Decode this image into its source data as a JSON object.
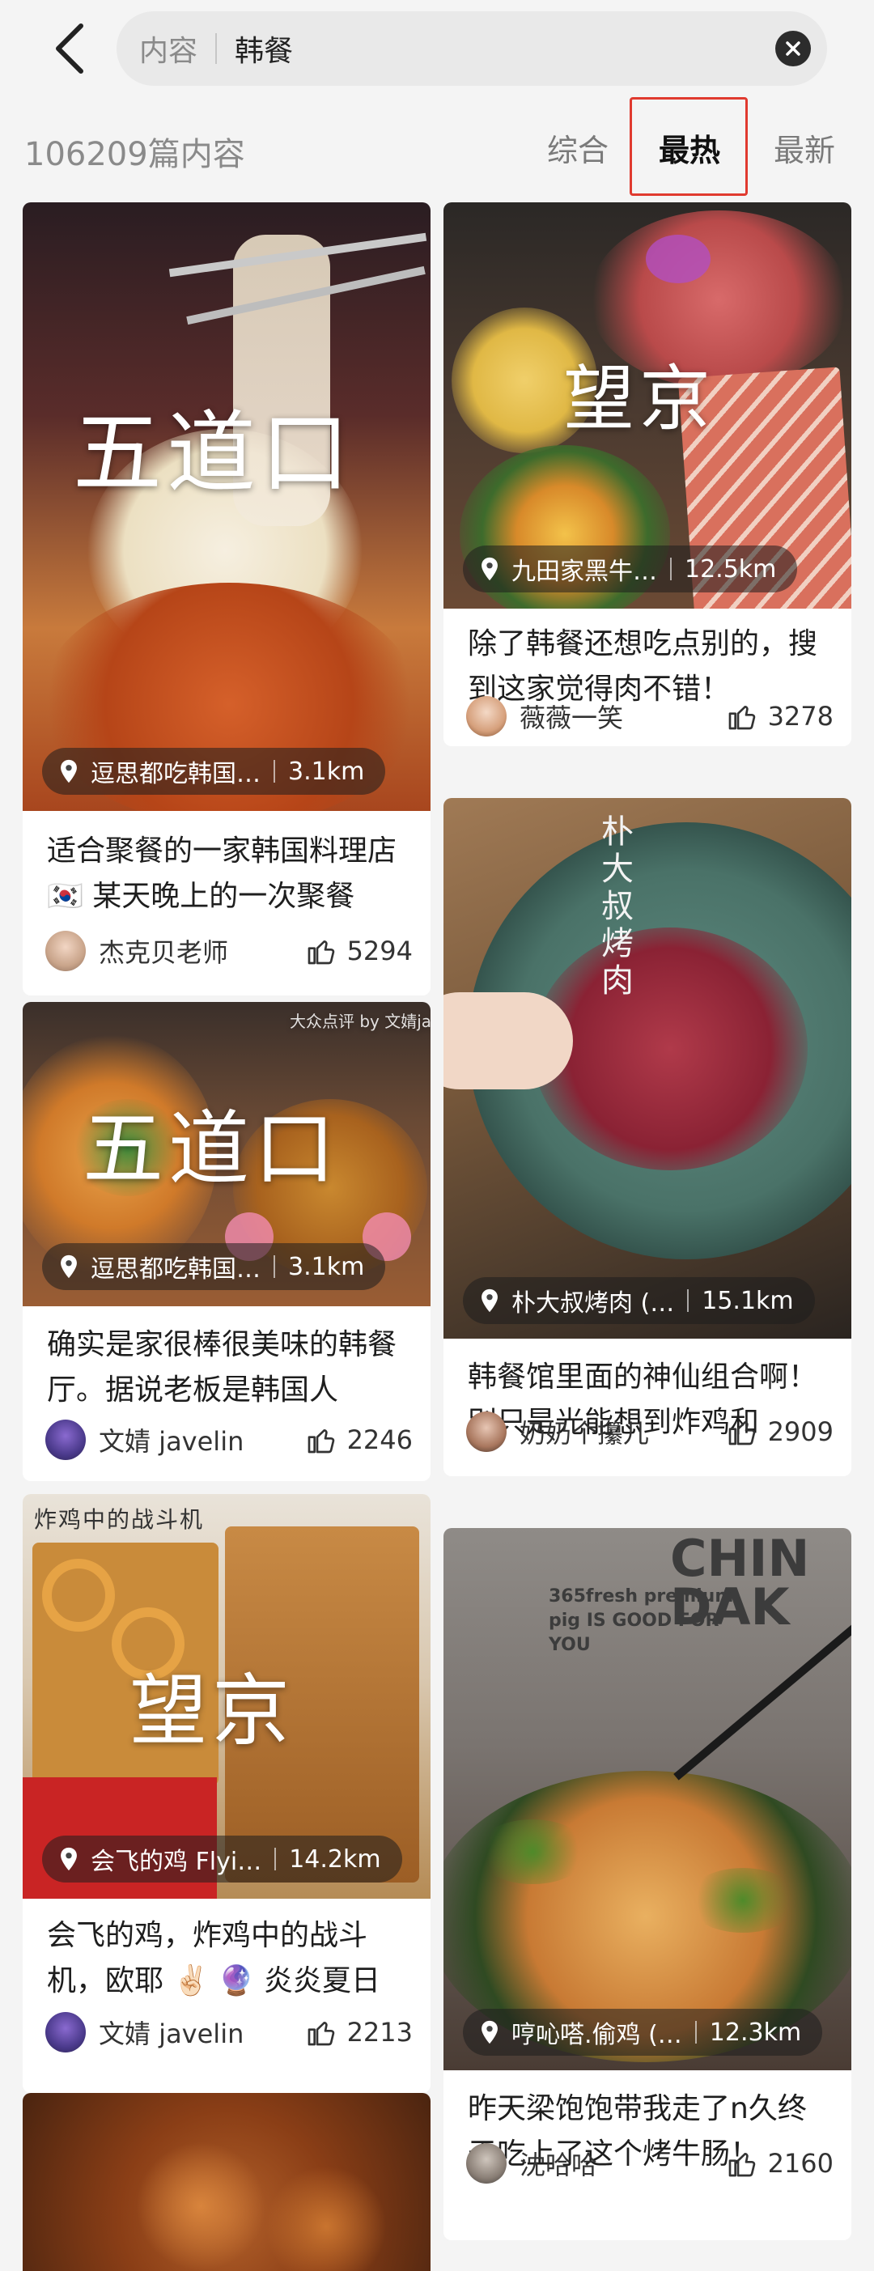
{
  "header": {
    "search_scope": "内容",
    "search_query": "韩餐"
  },
  "sortbar": {
    "result_count": "106209篇内容",
    "tabs": [
      {
        "label": "综合",
        "active": false
      },
      {
        "label": "最热",
        "active": true
      },
      {
        "label": "最新",
        "active": false
      }
    ]
  },
  "cards": [
    {
      "overlay": "五道口",
      "location": "逗思都吃韩国…",
      "distance": "3.1km",
      "title": "适合聚餐的一家韩国料理店 🇰🇷 某天晚上的一次聚餐",
      "author": "杰克贝老师",
      "likes": "5294"
    },
    {
      "overlay": "五道口",
      "watermark": "大众点评 by 文婧javelin VIP",
      "location": "逗思都吃韩国…",
      "distance": "3.1km",
      "title": "确实是家很棒很美味的韩餐厅。据说老板是韩国人",
      "author": "文婧 javelin",
      "likes": "2246"
    },
    {
      "overlay": "望京",
      "sign": "炸鸡中的战斗机",
      "location": "会飞的鸡 Flyi…",
      "distance": "14.2km",
      "title": "会飞的鸡，炸鸡中的战斗机，欧耶 ✌🏻 🔮 炎炎夏日",
      "author": "文婧 javelin",
      "likes": "2213"
    },
    {
      "overlay": "望京",
      "location": "九田家黑牛…",
      "distance": "12.5km",
      "title": "除了韩餐还想吃点别的，搜到这家觉得肉不错！",
      "author": "薇薇一笑",
      "likes": "3278"
    },
    {
      "overlay": "朴大叔烤肉",
      "location": "朴大叔烤肉 (…",
      "distance": "15.1km",
      "title": "韩餐馆里面的神仙组合啊！ 别只是光能想到炸鸡和",
      "author": "奶奶个攥儿",
      "likes": "2909"
    },
    {
      "wall_text": "CHIN DAK",
      "wall_sub": "365fresh premium pig IS GOOD FOR YOU",
      "location": "哼吣嗒.偷鸡 (…",
      "distance": "12.3km",
      "title": "昨天梁饱饱带我走了n久终于吃上了这个烤牛肠！",
      "author": "沈哈哈",
      "likes": "2160"
    }
  ],
  "colors": {
    "accent": "#e03a2f",
    "background": "#f4f4f4"
  },
  "icons": [
    "back-arrow-icon",
    "clear-icon",
    "location-pin-icon",
    "thumbs-up-icon"
  ]
}
